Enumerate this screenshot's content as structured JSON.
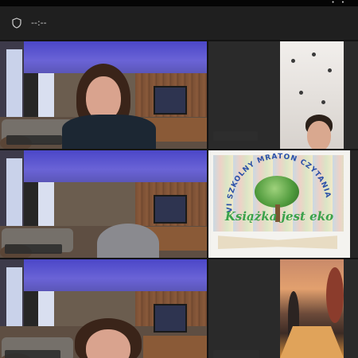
{
  "window": {
    "controls_glyph": "• •"
  },
  "toolbar": {
    "shield_icon": "shield-icon",
    "timer": "--:--"
  },
  "tiles": [
    {
      "kind": "camera",
      "scene": "living-room",
      "person": "woman-dark-sweater"
    },
    {
      "kind": "camera",
      "scene": "ceiling",
      "person": "boy-bottom"
    },
    {
      "kind": "camera",
      "scene": "living-room",
      "person": "head-bottom"
    },
    {
      "kind": "logo",
      "arc_text": "VI SZKOLNY MRATON CZYTANIA",
      "title": "Książka jest eko"
    },
    {
      "kind": "camera",
      "scene": "living-room",
      "person": "woman-bottom",
      "active": true
    },
    {
      "kind": "camera",
      "scene": "autumn-sunset"
    }
  ],
  "colors": {
    "background": "#141414",
    "toolbar": "#1f1f1f",
    "active_outline": "#7a7fe6",
    "logo_green": "#3aa24a",
    "logo_blue": "#2a4fa8"
  }
}
